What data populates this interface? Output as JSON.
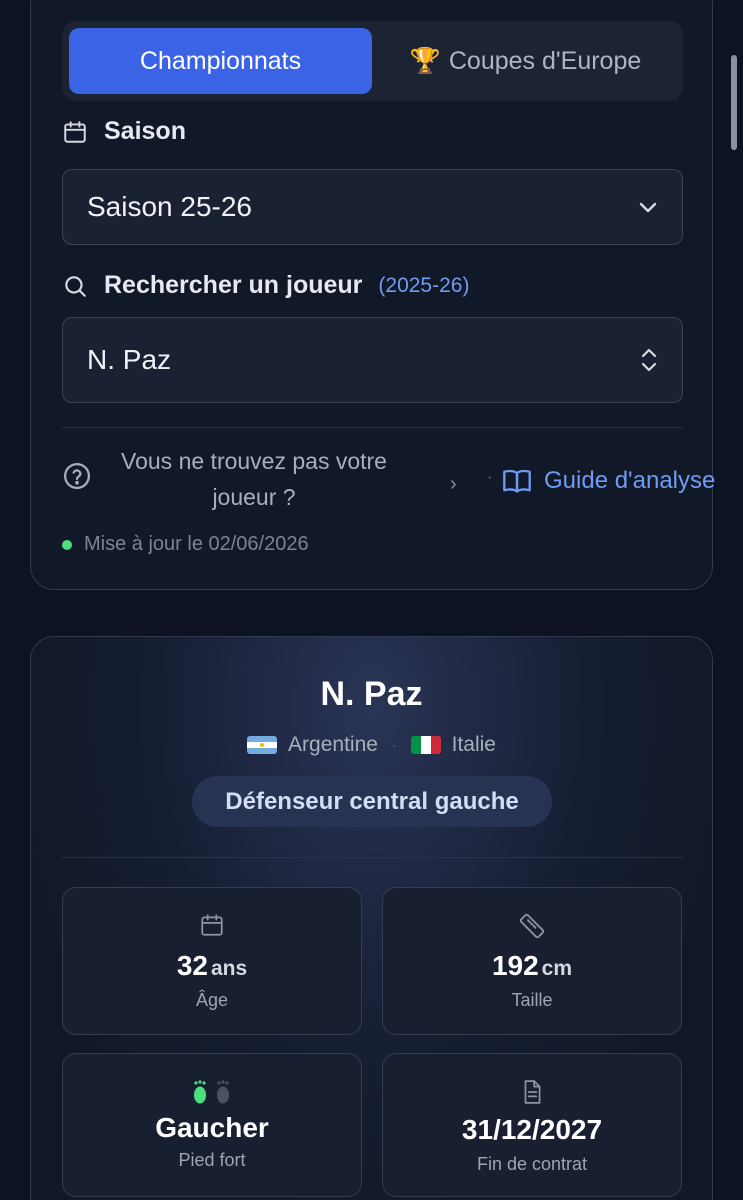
{
  "tabs": {
    "championnats": "Championnats",
    "coupes_icon": "🏆",
    "coupes": "Coupes d'Europe"
  },
  "season": {
    "label": "Saison",
    "value": "Saison 25-26"
  },
  "search": {
    "label": "Rechercher un joueur",
    "hint": "(2025-26)",
    "value": "N. Paz"
  },
  "help": {
    "line1": "Vous ne trouvez pas votre",
    "line2": "joueur ?",
    "chevron": "›",
    "sep": "·",
    "guide": "Guide d'analyse"
  },
  "update": {
    "text": "Mise à jour le 02/06/2026"
  },
  "player": {
    "name": "N. Paz",
    "nation1": "Argentine",
    "nation_sep": "·",
    "nation2": "Italie",
    "position": "Défenseur central gauche",
    "age": {
      "value": "32",
      "unit": "ans",
      "label": "Âge"
    },
    "height": {
      "value": "192",
      "unit": "cm",
      "label": "Taille"
    },
    "foot": {
      "value": "Gaucher",
      "label": "Pied fort"
    },
    "contract": {
      "value": "31/12/2027",
      "label": "Fin de contrat"
    }
  },
  "colors": {
    "accent": "#3b63e6",
    "link": "#6f9cf2",
    "status_green": "#4ade80",
    "background": "#0d1322"
  }
}
